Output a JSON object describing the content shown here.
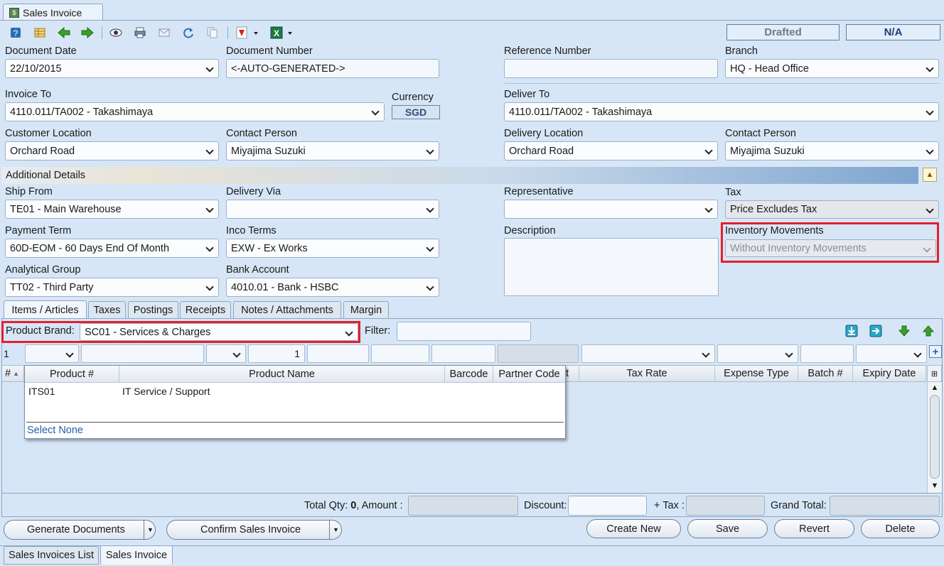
{
  "window": {
    "tab_title": "Sales Invoice"
  },
  "toolbar": {
    "icons": [
      "help-icon",
      "grid-icon",
      "back-arrow-icon",
      "forward-arrow-icon",
      "preview-eye-icon",
      "print-icon",
      "email-icon",
      "refresh-icon",
      "copy-icon",
      "pdf-export-icon",
      "excel-export-icon"
    ]
  },
  "status": {
    "state": "Drafted",
    "secondary": "N/A"
  },
  "header": {
    "document_date_label": "Document Date",
    "document_date": "22/10/2015",
    "document_number_label": "Document Number",
    "document_number": "<-AUTO-GENERATED->",
    "reference_number_label": "Reference Number",
    "reference_number": "",
    "branch_label": "Branch",
    "branch": "HQ - Head Office",
    "invoice_to_label": "Invoice To",
    "invoice_to": "4110.011/TA002 - Takashimaya",
    "currency_label": "Currency",
    "currency": "SGD",
    "deliver_to_label": "Deliver To",
    "deliver_to": "4110.011/TA002 - Takashimaya",
    "customer_location_label": "Customer Location",
    "customer_location": "Orchard Road",
    "contact_person_label": "Contact Person",
    "contact_person": "Miyajima Suzuki",
    "delivery_location_label": "Delivery Location",
    "delivery_location": "Orchard Road",
    "delivery_contact_person_label": "Contact Person",
    "delivery_contact_person": "Miyajima Suzuki"
  },
  "additional": {
    "title": "Additional Details",
    "ship_from_label": "Ship From",
    "ship_from": "TE01 - Main Warehouse",
    "delivery_via_label": "Delivery Via",
    "delivery_via": "",
    "representative_label": "Representative",
    "representative": "",
    "tax_label": "Tax",
    "tax": "Price Excludes Tax",
    "payment_term_label": "Payment Term",
    "payment_term": "60D-EOM - 60 Days End Of Month",
    "inco_terms_label": "Inco Terms",
    "inco_terms": "EXW - Ex Works",
    "description_label": "Description",
    "description": "",
    "inventory_movements_label": "Inventory Movements",
    "inventory_movements": "Without Inventory Movements",
    "analytical_group_label": "Analytical Group",
    "analytical_group": "TT02 - Third Party",
    "bank_account_label": "Bank Account",
    "bank_account": "4010.01 - Bank - HSBC"
  },
  "tabs": [
    {
      "label": "Items / Articles"
    },
    {
      "label": "Taxes"
    },
    {
      "label": "Postings"
    },
    {
      "label": "Receipts"
    },
    {
      "label": "Notes / Attachments"
    },
    {
      "label": "Margin"
    }
  ],
  "items": {
    "product_brand_label": "Product Brand:",
    "product_brand": "SC01 - Services & Charges",
    "filter_label": "Filter:",
    "filter": "",
    "row_no": "1",
    "qty": "1",
    "columns": [
      "#",
      "Tax Rate",
      "Expense Type",
      "Batch #",
      "Expiry Date"
    ],
    "col_partial": "t"
  },
  "popup": {
    "columns": [
      "Product #",
      "Product Name",
      "Barcode",
      "Partner Code"
    ],
    "rows": [
      {
        "product_no": "ITS01",
        "product_name": "IT Service / Support"
      }
    ],
    "select_none": "Select None"
  },
  "totals": {
    "total_qty_label": "Total Qty:",
    "total_qty": "0",
    "amount_label": ", Amount :",
    "discount_label": "Discount:",
    "tax_label": "+ Tax :",
    "grand_total_label": "Grand Total:"
  },
  "actions": {
    "generate_documents": "Generate Documents",
    "confirm_sales_invoice": "Confirm Sales Invoice",
    "create_new": "Create New",
    "save": "Save",
    "revert": "Revert",
    "delete": "Delete"
  },
  "bottom_tabs": [
    {
      "label": "Sales Invoices List"
    },
    {
      "label": "Sales Invoice"
    }
  ]
}
